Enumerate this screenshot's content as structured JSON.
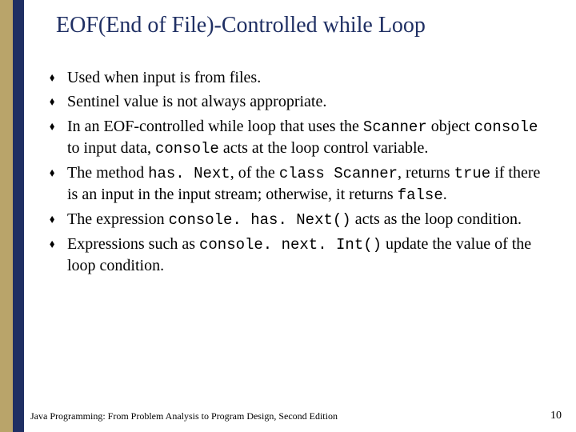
{
  "title": "EOF(End of File)-Controlled while Loop",
  "bullets": [
    {
      "segs": [
        {
          "t": "Used when input is from files."
        }
      ]
    },
    {
      "segs": [
        {
          "t": "Sentinel value is not always appropriate."
        }
      ]
    },
    {
      "segs": [
        {
          "t": "In an EOF-controlled while loop that uses the "
        },
        {
          "t": "Scanner",
          "mono": true
        },
        {
          "t": " object "
        },
        {
          "t": "console",
          "mono": true
        },
        {
          "t": " to input data, "
        },
        {
          "t": "console",
          "mono": true
        },
        {
          "t": " acts at the loop control variable."
        }
      ]
    },
    {
      "segs": [
        {
          "t": "The method "
        },
        {
          "t": "has. Next",
          "mono": true
        },
        {
          "t": ", of the "
        },
        {
          "t": "class Scanner",
          "mono": true
        },
        {
          "t": ", returns "
        },
        {
          "t": "true",
          "mono": true
        },
        {
          "t": " if there is an input in the input stream; otherwise, it returns "
        },
        {
          "t": "false",
          "mono": true
        },
        {
          "t": "."
        }
      ]
    },
    {
      "segs": [
        {
          "t": "The expression "
        },
        {
          "t": "console. has. Next()",
          "mono": true
        },
        {
          "t": " acts as the loop condition."
        }
      ]
    },
    {
      "segs": [
        {
          "t": "Expressions such as "
        },
        {
          "t": "console. next. Int()",
          "mono": true
        },
        {
          "t": " update the value of the loop condition."
        }
      ]
    }
  ],
  "footer": {
    "left": "Java Programming: From Problem Analysis to Program Design, Second Edition",
    "right": "10"
  },
  "bullet_glyph": "⬧"
}
